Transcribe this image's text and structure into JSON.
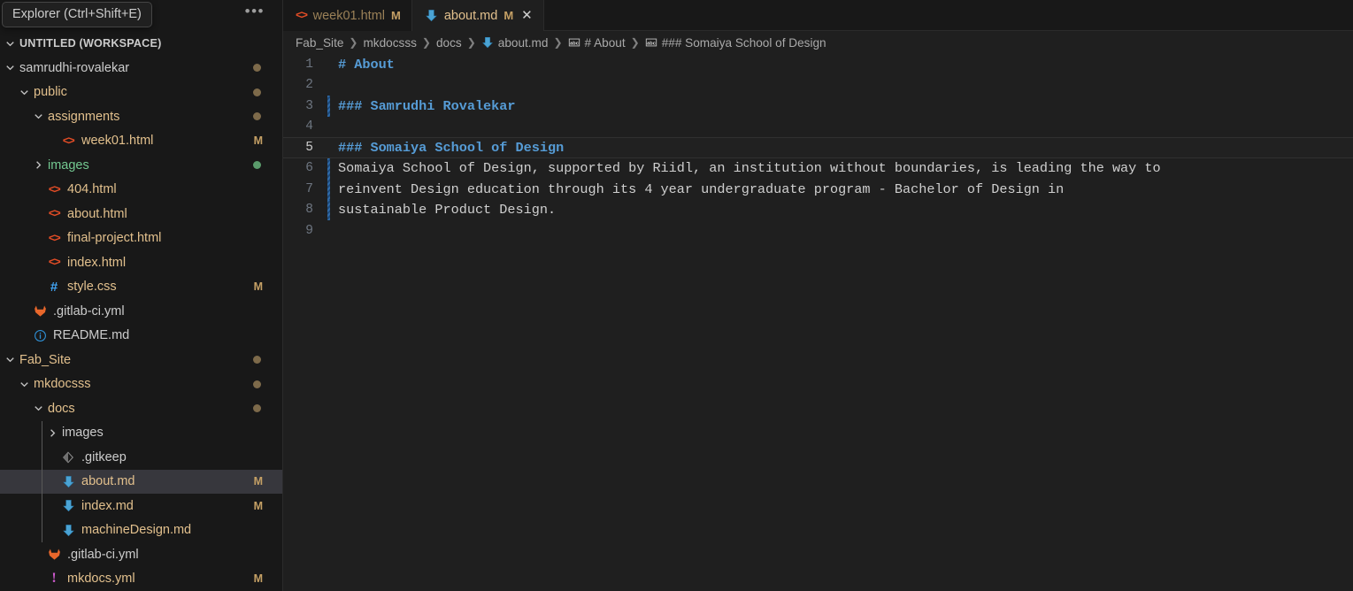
{
  "sidebar": {
    "tooltip": "Explorer (Ctrl+Shift+E)",
    "more_label": "•••",
    "workspace_label": "UNTITLED (WORKSPACE)",
    "items": [
      {
        "label": "samrudhi-rovalekar",
        "kind": "folder",
        "indent": 1,
        "expanded": true,
        "color": "white",
        "dot": "mod"
      },
      {
        "label": "public",
        "kind": "folder",
        "indent": 2,
        "expanded": true,
        "color": "mod",
        "dot": "mod"
      },
      {
        "label": "assignments",
        "kind": "folder",
        "indent": 3,
        "expanded": true,
        "color": "mod",
        "dot": "mod"
      },
      {
        "label": "week01.html",
        "kind": "html",
        "indent": 4,
        "color": "mod",
        "badge": "M"
      },
      {
        "label": "images",
        "kind": "folder",
        "indent": 3,
        "expanded": false,
        "color": "untr",
        "dot": "untr"
      },
      {
        "label": "404.html",
        "kind": "html",
        "indent": 3,
        "color": "mod"
      },
      {
        "label": "about.html",
        "kind": "html",
        "indent": 3,
        "color": "mod"
      },
      {
        "label": "final-project.html",
        "kind": "html",
        "indent": 3,
        "color": "mod"
      },
      {
        "label": "index.html",
        "kind": "html",
        "indent": 3,
        "color": "mod"
      },
      {
        "label": "style.css",
        "kind": "css",
        "indent": 3,
        "color": "mod",
        "badge": "M"
      },
      {
        "label": ".gitlab-ci.yml",
        "kind": "gitlab",
        "indent": 2,
        "color": "white"
      },
      {
        "label": "README.md",
        "kind": "readme",
        "indent": 2,
        "color": "white"
      },
      {
        "label": "Fab_Site",
        "kind": "folder",
        "indent": 1,
        "expanded": true,
        "color": "mod",
        "dot": "mod"
      },
      {
        "label": "mkdocsss",
        "kind": "folder",
        "indent": 2,
        "expanded": true,
        "color": "mod",
        "dot": "mod"
      },
      {
        "label": "docs",
        "kind": "folder",
        "indent": 3,
        "expanded": true,
        "color": "mod",
        "dot": "mod"
      },
      {
        "label": "images",
        "kind": "folder",
        "indent": 4,
        "expanded": false,
        "color": "white"
      },
      {
        "label": ".gitkeep",
        "kind": "gitkeep",
        "indent": 4,
        "color": "white"
      },
      {
        "label": "about.md",
        "kind": "md",
        "indent": 4,
        "color": "mod",
        "badge": "M",
        "selected": true
      },
      {
        "label": "index.md",
        "kind": "md",
        "indent": 4,
        "color": "mod",
        "badge": "M"
      },
      {
        "label": "machineDesign.md",
        "kind": "md",
        "indent": 4,
        "color": "mod"
      },
      {
        "label": ".gitlab-ci.yml",
        "kind": "gitlab",
        "indent": 3,
        "color": "white"
      },
      {
        "label": "mkdocs.yml",
        "kind": "yml",
        "indent": 3,
        "color": "mod",
        "badge": "M"
      }
    ]
  },
  "tabs": [
    {
      "label": "week01.html",
      "icon": "html-icon",
      "dirty": "M",
      "active": false,
      "closable": false
    },
    {
      "label": "about.md",
      "icon": "markdown-icon",
      "dirty": "M",
      "active": true,
      "closable": true,
      "close_glyph": "✕"
    }
  ],
  "breadcrumb": {
    "separator": "❯",
    "crumbs": [
      {
        "label": "Fab_Site",
        "icon": null
      },
      {
        "label": "mkdocsss",
        "icon": null
      },
      {
        "label": "docs",
        "icon": null
      },
      {
        "label": "about.md",
        "icon": "markdown-icon"
      },
      {
        "label": "# About",
        "icon": "symbol-string-icon"
      },
      {
        "label": "### Somaiya School of Design",
        "icon": "symbol-string-icon"
      }
    ]
  },
  "editor": {
    "lines": [
      {
        "n": "1",
        "current": false,
        "diff": "none",
        "segments": [
          {
            "text": "# About",
            "tok": "head"
          }
        ]
      },
      {
        "n": "2",
        "current": false,
        "diff": "none",
        "segments": []
      },
      {
        "n": "3",
        "current": false,
        "diff": "added",
        "segments": [
          {
            "text": "### Samrudhi Rovalekar",
            "tok": "head"
          }
        ]
      },
      {
        "n": "4",
        "current": false,
        "diff": "none",
        "segments": []
      },
      {
        "n": "5",
        "current": true,
        "diff": "none",
        "segments": [
          {
            "text": "### Somaiya School of Design",
            "tok": "head"
          }
        ]
      },
      {
        "n": "6",
        "current": false,
        "diff": "added",
        "segments": [
          {
            "text": "Somaiya School of Design, supported by Riidl, an institution without boundaries, is leading the way to",
            "tok": "plain"
          }
        ]
      },
      {
        "n": "7",
        "current": false,
        "diff": "added",
        "segments": [
          {
            "text": "reinvent Design education through its 4 year undergraduate program - Bachelor of Design in",
            "tok": "plain"
          }
        ]
      },
      {
        "n": "8",
        "current": false,
        "diff": "added",
        "segments": [
          {
            "text": "sustainable Product Design.",
            "tok": "plain"
          }
        ]
      },
      {
        "n": "9",
        "current": false,
        "diff": "none",
        "segments": []
      }
    ]
  }
}
